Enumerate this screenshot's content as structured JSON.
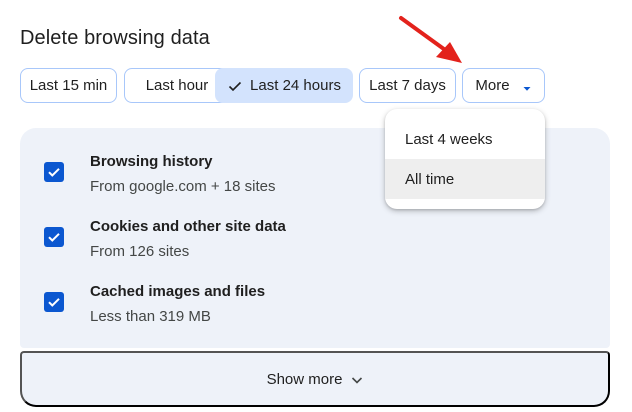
{
  "page": {
    "title": "Delete browsing data"
  },
  "time_chips": [
    {
      "label": "Last 15 min",
      "selected": false
    },
    {
      "label": "Last hour",
      "selected": false
    },
    {
      "label": "Last 24 hours",
      "selected": true
    },
    {
      "label": "Last 7 days",
      "selected": false
    },
    {
      "label": "More",
      "selected": false
    }
  ],
  "data_types": [
    {
      "title": "Browsing history",
      "subtitle": "From google.com + 18 sites",
      "checked": true
    },
    {
      "title": "Cookies and other site data",
      "subtitle": "From 126 sites",
      "checked": true
    },
    {
      "title": "Cached images and files",
      "subtitle": "Less than 319 MB",
      "checked": true
    }
  ],
  "show_more_label": "Show more",
  "more_menu": {
    "items": [
      {
        "label": "Last 4 weeks",
        "hovered": false
      },
      {
        "label": "All time",
        "hovered": true
      }
    ]
  },
  "icons": {
    "checkmark": "check-icon",
    "dropdown": "caret-down-icon",
    "show_more": "chevron-down-icon",
    "annotation": "red-arrow-icon"
  },
  "colors": {
    "accent": "#0b57d0",
    "chip_border": "#a8c7fa",
    "chip_selected": "#d3e3fd",
    "panel_bg": "#eef2f9",
    "annotation_arrow": "#e3221c"
  }
}
